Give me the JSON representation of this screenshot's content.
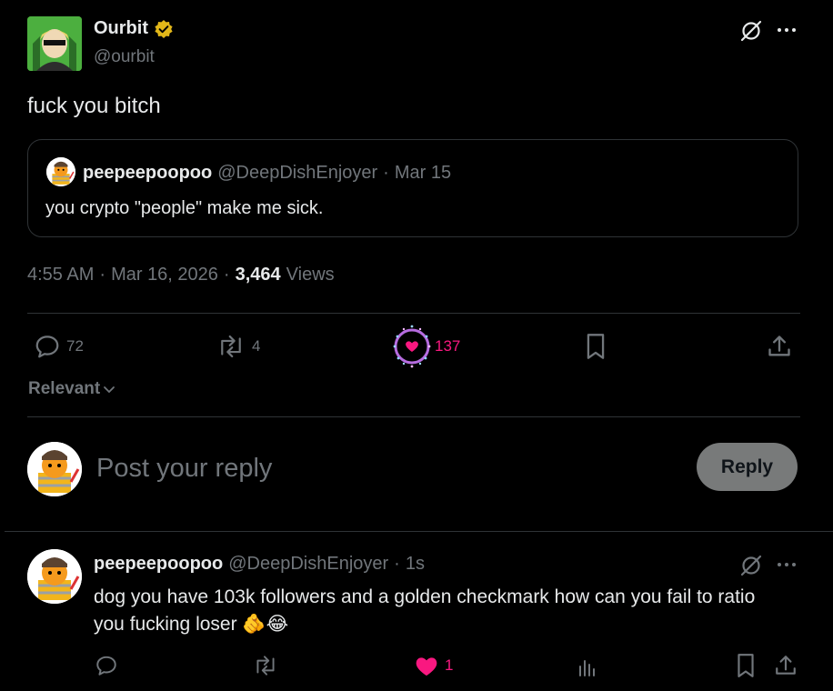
{
  "post": {
    "author_name": "Ourbit",
    "author_handle": "@ourbit",
    "text": "fuck you bitch",
    "time": "4:55 AM",
    "date": "Mar 16, 2026",
    "views_count": "3,464",
    "views_label": "Views",
    "sep": "·",
    "quote": {
      "author_name": "peepeepoopoo",
      "author_handle": "@DeepDishEnjoyer",
      "date": "Mar 15",
      "text": "you crypto \"people\" make me sick."
    },
    "actions": {
      "replies": "72",
      "reposts": "4",
      "likes": "137"
    }
  },
  "sort_label": "Relevant",
  "composer": {
    "placeholder": "Post your reply",
    "reply_button": "Reply"
  },
  "reply": {
    "author_name": "peepeepoopoo",
    "author_handle": "@DeepDishEnjoyer",
    "time": "1s",
    "text": "dog you have 103k followers and a golden checkmark how can you fail to ratio you fucking loser 🫵😂",
    "likes": "1"
  },
  "colors": {
    "like_pink": "#f91880",
    "verified_gold": "#e2b719",
    "reply_button_bg": "#787a7a",
    "divider": "#2f3336"
  },
  "icons": [
    "grok-icon",
    "more-icon",
    "verified-badge-icon",
    "reply-icon",
    "repost-icon",
    "like-icon",
    "bookmark-icon",
    "share-icon",
    "views-icon",
    "chevron-down-icon"
  ]
}
